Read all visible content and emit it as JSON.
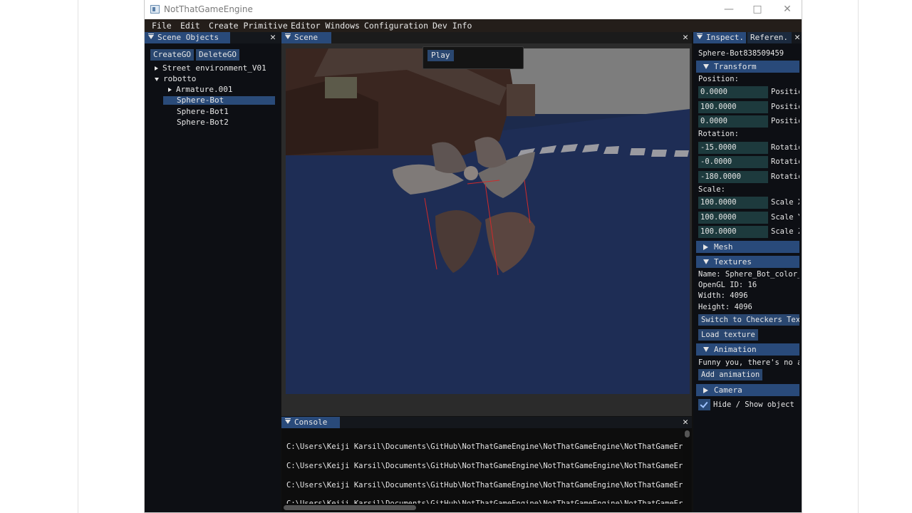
{
  "window": {
    "title": "NotThatGameEngine"
  },
  "menu": [
    "File",
    "Edit",
    "Create Primitive",
    "Editor Windows",
    "Configuration",
    "Dev Info"
  ],
  "scene_objects": {
    "tab": "Scene Objects",
    "create_btn": "CreateGO",
    "delete_btn": "DeleteGO",
    "tree": [
      {
        "label": "Street environment_V01",
        "expanded": false
      },
      {
        "label": "robotto",
        "expanded": true
      },
      {
        "label": "Armature.001",
        "expanded": false
      },
      {
        "label": "Sphere-Bot",
        "selected": true
      },
      {
        "label": "Sphere-Bot1"
      },
      {
        "label": "Sphere-Bot2"
      }
    ]
  },
  "scene": {
    "tab": "Scene",
    "play": "Play"
  },
  "console": {
    "tab": "Console",
    "lines": [
      "C:\\Users\\Keiji Karsil\\Documents\\GitHub\\NotThatGameEngine\\NotThatGameEngine\\NotThatGameEr",
      "C:\\Users\\Keiji Karsil\\Documents\\GitHub\\NotThatGameEngine\\NotThatGameEngine\\NotThatGameEr",
      "C:\\Users\\Keiji Karsil\\Documents\\GitHub\\NotThatGameEngine\\NotThatGameEngine\\NotThatGameEr",
      "C:\\Users\\Keiji Karsil\\Documents\\GitHub\\NotThatGameEngine\\NotThatGameEngine\\NotThatGameEr"
    ]
  },
  "inspector": {
    "tab": "Inspect.",
    "tab2": "Referen.",
    "object_name": "Sphere-Bot838509459",
    "transform": {
      "header": "Transform",
      "position_label": "Position:",
      "position": [
        {
          "value": "0.0000",
          "label": "Positic"
        },
        {
          "value": "100.0000",
          "label": "Positic"
        },
        {
          "value": "0.0000",
          "label": "Positic"
        }
      ],
      "rotation_label": "Rotation:",
      "rotation": [
        {
          "value": "-15.0000",
          "label": "Rotatic"
        },
        {
          "value": "-0.0000",
          "label": "Rotatic"
        },
        {
          "value": "-180.0000",
          "label": "Rotatic"
        }
      ],
      "scale_label": "Scale:",
      "scale": [
        {
          "value": "100.0000",
          "label": "Scale X"
        },
        {
          "value": "100.0000",
          "label": "Scale Y"
        },
        {
          "value": "100.0000",
          "label": "Scale Z"
        }
      ]
    },
    "mesh": {
      "header": "Mesh"
    },
    "textures": {
      "header": "Textures",
      "name": "Name: Sphere_Bot_color_",
      "opengl_id": "OpenGL ID: 16",
      "width": "Width: 4096",
      "height": "Height: 4096",
      "switch_btn": "Switch to Checkers Tex",
      "load_btn": "Load texture"
    },
    "animation": {
      "header": "Animation",
      "text": "Funny you, there's no a",
      "add_btn": "Add animation"
    },
    "camera": {
      "header": "Camera"
    },
    "hide_show": {
      "label": "Hide / Show object",
      "checked": true
    }
  }
}
